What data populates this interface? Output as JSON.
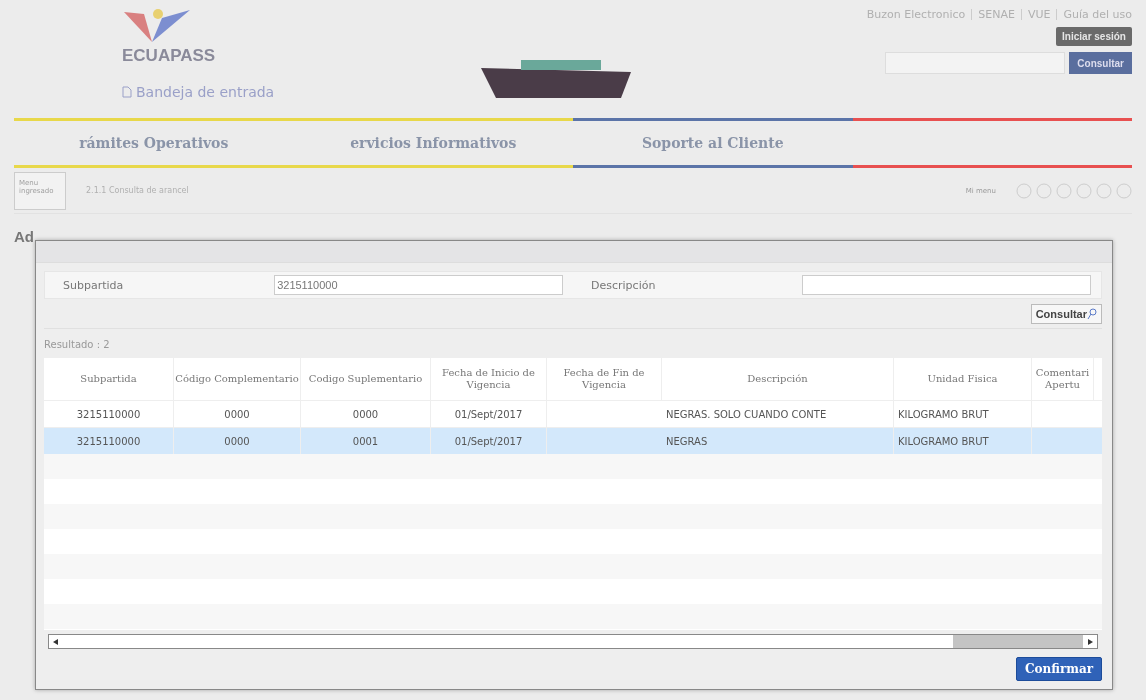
{
  "header": {
    "logo_text": "ECUAPASS",
    "inbox_link": "Bandeja de entrada",
    "top_links": [
      "Buzon Electronico",
      "SENAE",
      "VUE",
      "Guía del uso"
    ],
    "login_button": "Iniciar sesión",
    "search_button": "Consultar"
  },
  "nav": {
    "items": [
      {
        "label": "rámites Operativos",
        "color": "#e8d84a"
      },
      {
        "label": "ervicios Informativos",
        "color": "#e8d84a"
      },
      {
        "label": "Soporte al Cliente",
        "color": "#5b74a8"
      },
      {
        "color": "#e85050"
      }
    ]
  },
  "breadcrumb": {
    "menu_tab": "Menu ingresado",
    "path": "2.1.1 Consulta de arancel",
    "my_menu": "Mi menu"
  },
  "page_title": "Ad",
  "dialog": {
    "form": {
      "fields": [
        {
          "label": "Subpartida",
          "value": "3215110000"
        },
        {
          "label": "Descripción"
        }
      ],
      "search_button": "Consultar"
    },
    "result_count": "Resultado : 2",
    "table": {
      "columns": [
        "Subpartida",
        "Código Complementario",
        "Codigo Suplementario",
        "Fecha de Inicio de Vigencia",
        "Fecha de Fin de Vigencia",
        "Descripción",
        "Unidad Fisica",
        "Comentari\nApertu"
      ],
      "rows": [
        {
          "cells": [
            "3215110000",
            "0000",
            "0000",
            "01/Sept/2017",
            "",
            "NEGRAS. SOLO CUANDO CONTE",
            "KILOGRAMO BRUT",
            ""
          ],
          "selected": false
        },
        {
          "cells": [
            "3215110000",
            "0000",
            "0001",
            "01/Sept/2017",
            "",
            "NEGRAS",
            "KILOGRAMO BRUT",
            ""
          ],
          "selected": true
        }
      ]
    },
    "confirm_button": "Confirmar"
  }
}
